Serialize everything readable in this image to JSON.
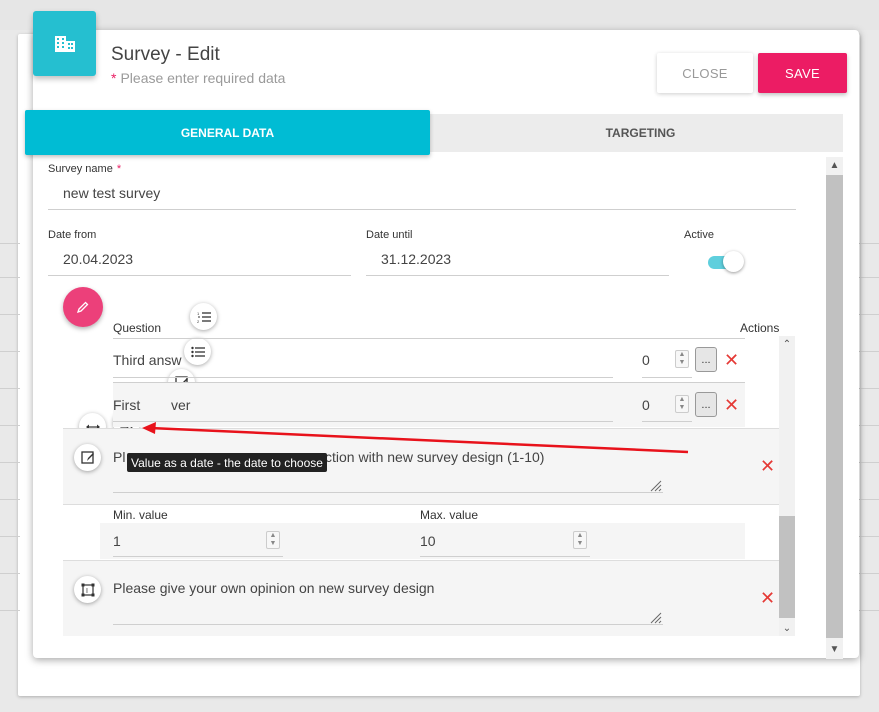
{
  "header": {
    "title": "Survey - Edit",
    "required_star": "*",
    "subtitle": "Please enter required data",
    "header_icon": "building-icon"
  },
  "buttons": {
    "close": "CLOSE",
    "save": "SAVE"
  },
  "tabs": [
    {
      "label": "GENERAL DATA",
      "active": true
    },
    {
      "label": "TARGETING",
      "active": false
    }
  ],
  "form": {
    "survey_name_label": "Survey name",
    "survey_name_star": "*",
    "survey_name_value": "new test survey",
    "date_from_label": "Date from",
    "date_from_value": "20.04.2023",
    "date_until_label": "Date until",
    "date_until_value": "31.12.2023",
    "active_label": "Active",
    "active_value": true
  },
  "questions": {
    "question_header": "Question",
    "actions_header": "Actions",
    "answers": [
      {
        "text": "Third answ",
        "value": "0",
        "dots": "..."
      },
      {
        "text": "First",
        "text_after": "ver",
        "value": "0",
        "dots": "..."
      }
    ],
    "rating_question": {
      "prefix": "Pl",
      "suffix": "ction with new survey design (1-10)"
    },
    "min_label": "Min. value",
    "min_value": "1",
    "max_label": "Max. value",
    "max_value": "10",
    "opinion_question": "Please give your own opinion on new survey design",
    "remove_symbol": "✕"
  },
  "tooltip": "Value as a date - the date to choose",
  "colors": {
    "accent": "#00bcd4",
    "save": "#ec1c64",
    "fab": "#ec407a",
    "arrow": "#e8121b",
    "remove": "#e53935"
  }
}
